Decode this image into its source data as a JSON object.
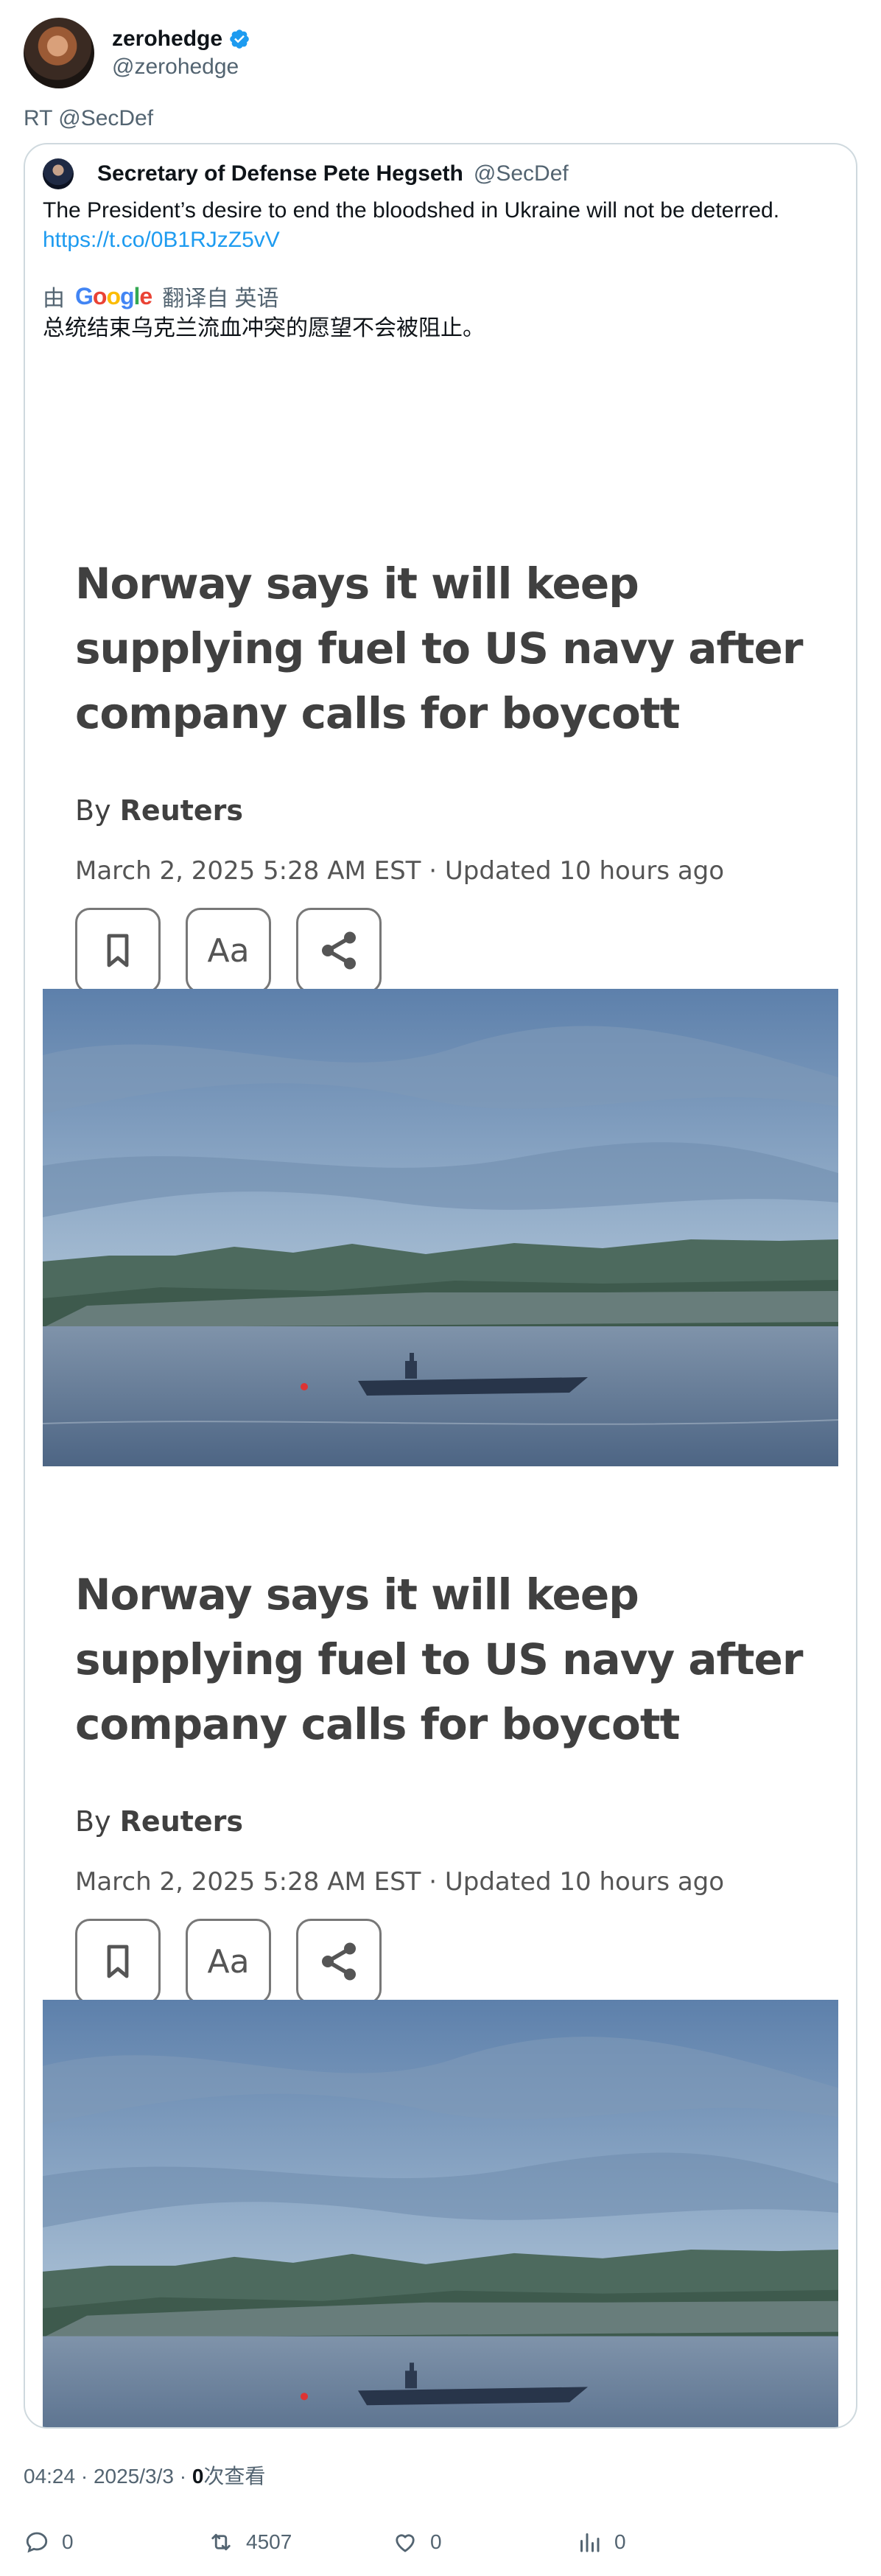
{
  "author": {
    "name": "zerohedge",
    "handle": "@zerohedge"
  },
  "retweet_label": "RT @SecDef",
  "quote": {
    "name": "Secretary of Defense Pete Hegseth",
    "handle": "@SecDef",
    "text": "The President’s desire to end the bloodshed in Ukraine will not be deterred.",
    "link": "https://t.co/0B1RJzZ5vV",
    "translation_by": "由",
    "translation_logo": "Google",
    "translation_from": "翻译自 英语",
    "translated_text": "总统结束乌克兰流血冲突的愿望不会被阻止。"
  },
  "articles": [
    {
      "title": "Norway says it will keep supplying fuel to US navy after company calls for boycott",
      "by": "By",
      "source": "Reuters",
      "date": "March 2, 2025 5:28 AM EST · Updated 10 hours ago",
      "text_size_label": "Aa"
    },
    {
      "title": "Norway says it will keep supplying fuel to US navy after company calls for boycott",
      "by": "By",
      "source": "Reuters",
      "date": "March 2, 2025 5:28 AM EST · Updated 10 hours ago",
      "text_size_label": "Aa"
    }
  ],
  "footer": {
    "time": "04:24 · 2025/3/3 · ",
    "views_count": "0",
    "views_label": "次查看"
  },
  "actions": {
    "replies": "0",
    "retweets": "4507",
    "likes": "0",
    "views": "0"
  },
  "colors": {
    "accent": "#1d9bf0",
    "text": "#0f1419",
    "muted": "#536471",
    "border": "#cfd9de"
  },
  "icons": [
    "verified-badge-icon",
    "bookmark-icon",
    "share-icon",
    "reply-icon",
    "retweet-icon",
    "like-icon",
    "views-icon"
  ]
}
